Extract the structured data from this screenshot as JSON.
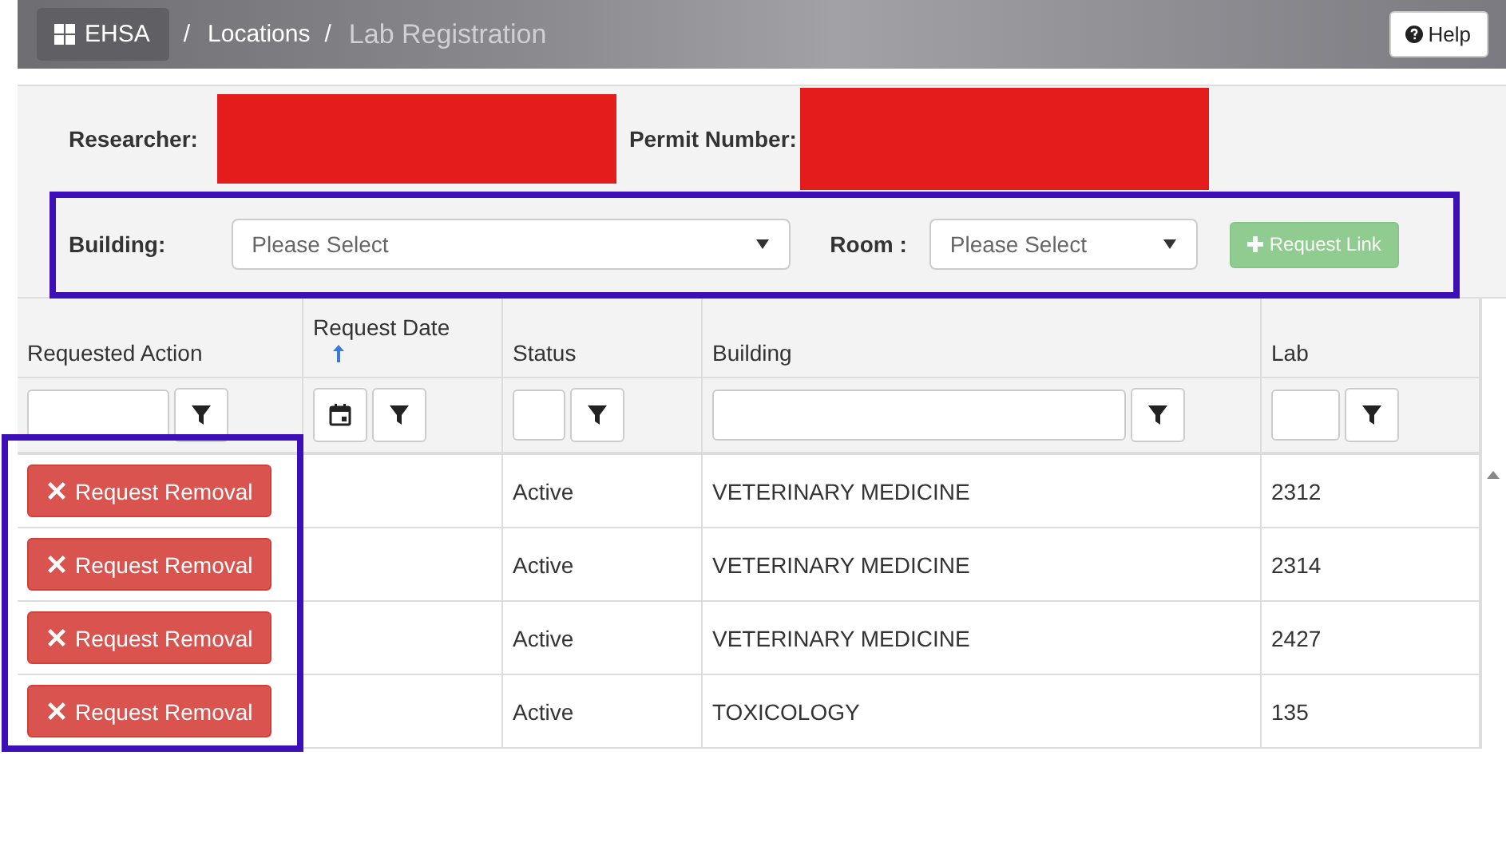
{
  "topbar": {
    "app_button": "EHSA",
    "breadcrumbs": [
      {
        "separator": "/",
        "label": "Locations",
        "current": false
      },
      {
        "separator": "/",
        "label": "Lab Registration",
        "current": true
      }
    ],
    "help_button": "Help"
  },
  "info": [
    {
      "label": "Researcher:",
      "redacted": true
    },
    {
      "label": "Permit Number:",
      "redacted": true
    }
  ],
  "filters": {
    "building": {
      "label": "Building:",
      "placeholder": "Please Select"
    },
    "room": {
      "label": "Room :",
      "placeholder": "Please Select"
    },
    "request_link": {
      "label": "Request Link",
      "disabled": true
    }
  },
  "table": {
    "columns": [
      {
        "label": "Requested Action",
        "kind": "text",
        "sorted": false
      },
      {
        "label": "Request Date",
        "kind": "date",
        "sorted": true
      },
      {
        "label": "Status",
        "kind": "text",
        "sorted": false
      },
      {
        "label": "Building",
        "kind": "text",
        "sorted": false
      },
      {
        "label": "Lab",
        "kind": "text",
        "sorted": false
      }
    ],
    "rows": [
      {
        "action": "Request Removal",
        "status": "Active",
        "building": "VETERINARY MEDICINE",
        "lab": "2312"
      },
      {
        "action": "Request Removal",
        "status": "Active",
        "building": "VETERINARY MEDICINE",
        "lab": "2314"
      },
      {
        "action": "Request Removal",
        "status": "Active",
        "building": "VETERINARY MEDICINE",
        "lab": "2427"
      },
      {
        "action": "Request Removal",
        "status": "Active",
        "building": "TOXICOLOGY",
        "lab": "135"
      }
    ]
  }
}
